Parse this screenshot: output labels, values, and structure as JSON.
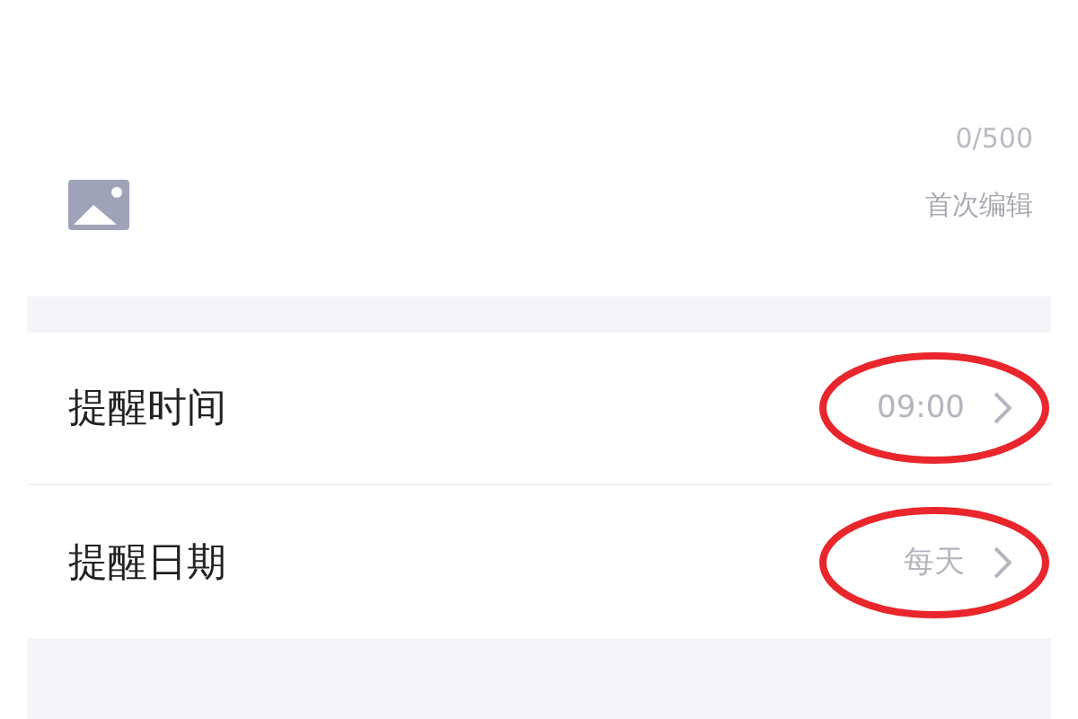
{
  "editor": {
    "counter": "0/500",
    "edit_status": "首次编辑"
  },
  "settings": [
    {
      "label": "提醒时间",
      "value": "09:00",
      "circled": true
    },
    {
      "label": "提醒日期",
      "value": "每天",
      "circled": true
    }
  ]
}
